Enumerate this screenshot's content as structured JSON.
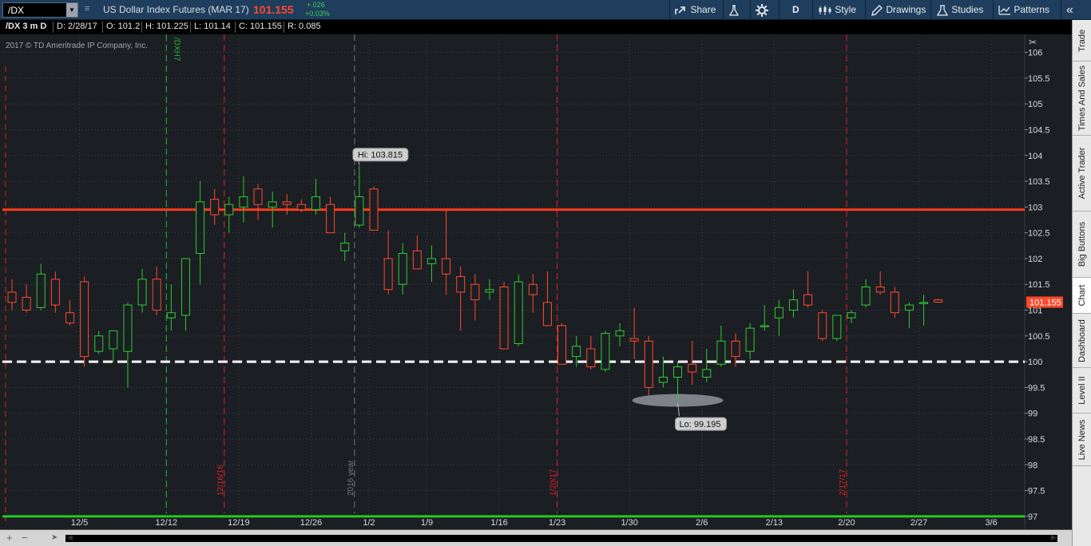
{
  "toolbar": {
    "symbol": "/DX",
    "instrument_name": "US Dollar Index Futures (MAR 17)",
    "last_price": "101.155",
    "net_change": "+.026",
    "percent_change": "+0.03%",
    "share_label": "Share",
    "aggregation_label": "D",
    "style_label": "Style",
    "drawings_label": "Drawings",
    "studies_label": "Studies",
    "patterns_label": "Patterns"
  },
  "info_bar": {
    "title": "/DX 3 m D",
    "date": "D: 2/28/17",
    "open": "O: 101.2",
    "high": "H: 101.225",
    "low": "L: 101.14",
    "close": "C: 101.155",
    "range": "R: 0.085"
  },
  "chart_data": {
    "type": "candlestick",
    "copyright": "2017 © TD Ameritrade IP Company, Inc.",
    "y_ticks": [
      "106",
      "105.5",
      "105",
      "104.5",
      "104",
      "103.5",
      "103",
      "102.5",
      "102",
      "101.5",
      "101",
      "100.5",
      "100",
      "99.5",
      "99",
      "98.5",
      "98",
      "97.5",
      "97"
    ],
    "x_ticks": [
      "12/5",
      "12/12",
      "12/19",
      "12/26",
      "1/2",
      "1/9",
      "1/16",
      "1/23",
      "1/30",
      "2/6",
      "2/13",
      "2/20",
      "2/27",
      "3/6"
    ],
    "ylim": [
      96.75,
      106.35
    ],
    "grid": true,
    "current_price_label": "101.155",
    "high_bubble": "Hi: 103.815",
    "low_bubble": "Lo: 99.195",
    "horizontal_levels": [
      {
        "value": 102.95,
        "color": "#ff3a1a",
        "style": "solid"
      },
      {
        "value": 100.0,
        "color": "#ffffff",
        "style": "dashed"
      },
      {
        "value": 97.0,
        "color": "#22cc22",
        "style": "solid"
      }
    ],
    "vertical_markers": [
      {
        "label": "/DXH7",
        "bar_index": 11,
        "color": "#22bb33"
      },
      {
        "label": "12/16/16",
        "bar_index": 15,
        "color": "#dd2222"
      },
      {
        "label": "2016 year",
        "bar_index": 24,
        "color": "#777777"
      },
      {
        "label": "1/20/17",
        "bar_index": 38,
        "color": "#dd2222"
      },
      {
        "label": "2/17/17",
        "bar_index": 58,
        "color": "#dd2222"
      }
    ],
    "candles": [
      [
        101.35,
        101.6,
        101.0,
        101.15
      ],
      [
        101.25,
        101.5,
        100.95,
        101.0
      ],
      [
        101.05,
        101.9,
        101.0,
        101.7
      ],
      [
        101.6,
        101.75,
        100.95,
        101.1
      ],
      [
        100.95,
        101.2,
        100.7,
        100.75
      ],
      [
        101.55,
        101.65,
        99.9,
        100.1
      ],
      [
        100.2,
        100.6,
        100.15,
        100.5
      ],
      [
        100.25,
        100.6,
        100.0,
        100.6
      ],
      [
        100.2,
        101.15,
        99.5,
        101.1
      ],
      [
        101.1,
        101.8,
        100.95,
        101.6
      ],
      [
        101.6,
        101.85,
        100.9,
        101.0
      ],
      [
        100.85,
        101.5,
        100.6,
        100.95
      ],
      [
        100.9,
        101.6,
        100.6,
        102.0
      ],
      [
        102.1,
        103.5,
        101.5,
        103.1
      ],
      [
        103.15,
        103.35,
        102.65,
        102.85
      ],
      [
        102.85,
        103.2,
        102.5,
        103.05
      ],
      [
        103.0,
        103.6,
        102.7,
        103.2
      ],
      [
        103.35,
        103.45,
        102.75,
        103.05
      ],
      [
        103.0,
        103.3,
        102.6,
        103.1
      ],
      [
        103.1,
        103.25,
        102.85,
        103.05
      ],
      [
        103.05,
        103.15,
        102.9,
        102.95
      ],
      [
        102.95,
        103.55,
        102.85,
        103.2
      ],
      [
        103.05,
        103.2,
        102.5,
        102.5
      ],
      [
        102.15,
        102.5,
        101.95,
        102.3
      ],
      [
        102.65,
        103.8,
        102.6,
        103.2
      ],
      [
        103.35,
        103.4,
        102.55,
        102.55
      ],
      [
        102.0,
        102.55,
        101.3,
        101.4
      ],
      [
        101.5,
        102.3,
        101.3,
        102.1
      ],
      [
        102.15,
        102.45,
        101.8,
        101.8
      ],
      [
        101.9,
        102.25,
        101.55,
        102.0
      ],
      [
        102.0,
        102.95,
        101.3,
        101.7
      ],
      [
        101.65,
        101.85,
        100.6,
        101.35
      ],
      [
        101.5,
        101.7,
        100.8,
        101.2
      ],
      [
        101.35,
        101.6,
        101.2,
        101.4
      ],
      [
        101.45,
        101.55,
        100.25,
        100.25
      ],
      [
        100.35,
        101.7,
        100.3,
        101.55
      ],
      [
        101.5,
        101.7,
        100.95,
        101.3
      ],
      [
        101.15,
        101.75,
        100.75,
        100.7
      ],
      [
        100.7,
        100.75,
        99.95,
        99.95
      ],
      [
        100.1,
        100.5,
        99.9,
        100.3
      ],
      [
        100.25,
        100.5,
        99.85,
        99.9
      ],
      [
        99.85,
        100.6,
        99.8,
        100.55
      ],
      [
        100.5,
        100.75,
        100.3,
        100.6
      ],
      [
        100.45,
        101.05,
        100.05,
        100.4
      ],
      [
        100.4,
        100.5,
        99.35,
        99.5
      ],
      [
        99.6,
        100.1,
        99.5,
        99.7
      ],
      [
        99.7,
        100.0,
        99.2,
        99.9
      ],
      [
        99.95,
        100.4,
        99.55,
        99.8
      ],
      [
        99.7,
        100.25,
        99.6,
        99.85
      ],
      [
        99.95,
        100.7,
        99.9,
        100.4
      ],
      [
        100.4,
        100.55,
        99.9,
        100.1
      ],
      [
        100.2,
        100.75,
        100.05,
        100.65
      ],
      [
        100.7,
        101.1,
        100.6,
        100.7
      ],
      [
        100.85,
        101.2,
        100.5,
        101.05
      ],
      [
        101.0,
        101.4,
        100.85,
        101.2
      ],
      [
        101.3,
        101.75,
        101.05,
        101.1
      ],
      [
        100.95,
        101.0,
        100.4,
        100.45
      ],
      [
        100.45,
        100.9,
        100.4,
        100.9
      ],
      [
        100.85,
        101.0,
        100.75,
        100.95
      ],
      [
        101.1,
        101.6,
        101.05,
        101.45
      ],
      [
        101.45,
        101.75,
        101.3,
        101.35
      ],
      [
        101.35,
        101.45,
        100.85,
        100.95
      ],
      [
        101.0,
        101.15,
        100.65,
        101.1
      ],
      [
        101.15,
        101.3,
        100.7,
        101.15
      ],
      [
        101.2,
        101.225,
        101.14,
        101.155
      ]
    ]
  },
  "side_tabs": [
    "Trade",
    "Times And Sales",
    "Active Trader",
    "Big Buttons",
    "Chart",
    "Dashboard",
    "Level II",
    "Live News"
  ]
}
